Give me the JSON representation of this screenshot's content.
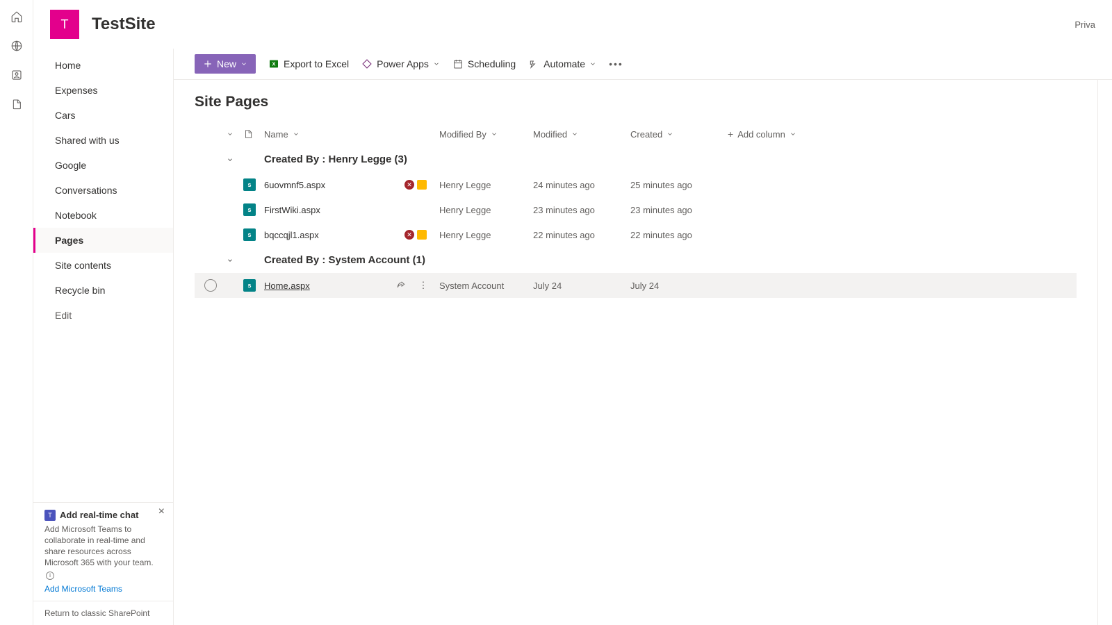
{
  "rail": {
    "icons": [
      "home",
      "globe",
      "contacts",
      "file"
    ]
  },
  "site": {
    "logo_letter": "T",
    "title": "TestSite",
    "privacy": "Priva"
  },
  "nav": {
    "items": [
      {
        "label": "Home"
      },
      {
        "label": "Expenses"
      },
      {
        "label": "Cars"
      },
      {
        "label": "Shared with us"
      },
      {
        "label": "Google"
      },
      {
        "label": "Conversations"
      },
      {
        "label": "Notebook"
      },
      {
        "label": "Pages",
        "selected": true
      },
      {
        "label": "Site contents"
      },
      {
        "label": "Recycle bin"
      },
      {
        "label": "Edit",
        "edit": true
      }
    ]
  },
  "promo": {
    "title": "Add real-time chat",
    "desc": "Add Microsoft Teams to collaborate in real-time and share resources across Microsoft 365 with your team.",
    "link": "Add Microsoft Teams"
  },
  "classic_link": "Return to classic SharePoint",
  "cmdbar": {
    "new": "New",
    "export": "Export to Excel",
    "powerapps": "Power Apps",
    "scheduling": "Scheduling",
    "automate": "Automate"
  },
  "list": {
    "heading": "Site Pages",
    "columns": {
      "name": "Name",
      "modby": "Modified By",
      "mod": "Modified",
      "created": "Created",
      "add": "Add column"
    },
    "groups": [
      {
        "title": "Created By : Henry Legge (3)",
        "items": [
          {
            "name": "6uovmnf5.aspx",
            "modby": "Henry Legge",
            "mod": "24 minutes ago",
            "created": "25 minutes ago",
            "status": true
          },
          {
            "name": "FirstWiki.aspx",
            "modby": "Henry Legge",
            "mod": "23 minutes ago",
            "created": "23 minutes ago",
            "status": false
          },
          {
            "name": "bqccqjl1.aspx",
            "modby": "Henry Legge",
            "mod": "22 minutes ago",
            "created": "22 minutes ago",
            "status": true
          }
        ]
      },
      {
        "title": "Created By : System Account (1)",
        "items": [
          {
            "name": "Home.aspx",
            "modby": "System Account",
            "mod": "July 24",
            "created": "July 24",
            "hover": true,
            "link": true
          }
        ]
      }
    ]
  }
}
